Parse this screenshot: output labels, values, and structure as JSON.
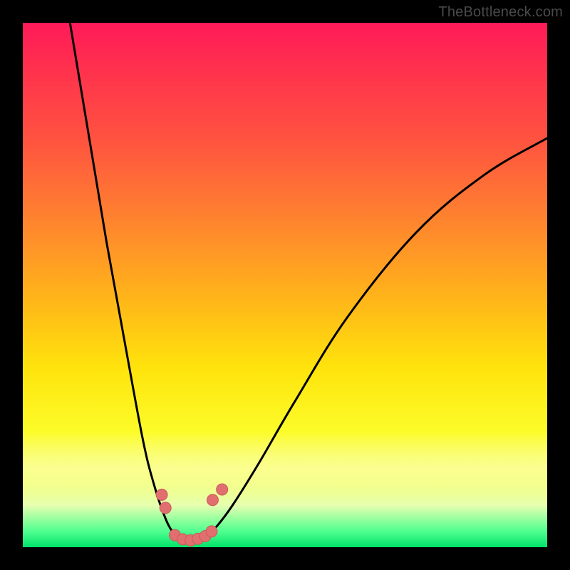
{
  "watermark": "TheBottleneck.com",
  "colors": {
    "background_frame": "#000000",
    "curve_stroke": "#000000",
    "marker_fill": "#e26f6f",
    "marker_stroke": "#c85a5a"
  },
  "chart_data": {
    "type": "line",
    "title": "",
    "xlabel": "",
    "ylabel": "",
    "xlim": [
      0,
      100
    ],
    "ylim": [
      0,
      100
    ],
    "grid": false,
    "legend": false,
    "note": "Conceptual bottleneck V-curve with no visible axis ticks or numeric labels; values are approximate geometry read from the plot area.",
    "series": [
      {
        "name": "left-branch",
        "x": [
          9,
          12,
          16,
          20,
          23,
          25,
          27,
          28.5,
          30
        ],
        "y": [
          100,
          82,
          58,
          36,
          20,
          12,
          6,
          3,
          1.5
        ]
      },
      {
        "name": "right-branch",
        "x": [
          35,
          37,
          40,
          45,
          52,
          62,
          75,
          88,
          100
        ],
        "y": [
          2,
          4,
          8,
          16,
          28,
          44,
          60,
          71,
          78
        ]
      },
      {
        "name": "valley-floor",
        "x": [
          28.5,
          30,
          32,
          34,
          35.5
        ],
        "y": [
          2,
          1.2,
          1,
          1.3,
          2
        ]
      }
    ],
    "markers": [
      {
        "x": 26.5,
        "y": 10,
        "r": 8
      },
      {
        "x": 27.2,
        "y": 7.5,
        "r": 8
      },
      {
        "x": 29,
        "y": 2.3,
        "r": 8
      },
      {
        "x": 30.5,
        "y": 1.5,
        "r": 8
      },
      {
        "x": 32,
        "y": 1.3,
        "r": 8
      },
      {
        "x": 33.4,
        "y": 1.6,
        "r": 8
      },
      {
        "x": 34.8,
        "y": 2.1,
        "r": 8
      },
      {
        "x": 36,
        "y": 3,
        "r": 8
      },
      {
        "x": 36.2,
        "y": 9,
        "r": 8
      },
      {
        "x": 38,
        "y": 11,
        "r": 8
      }
    ]
  }
}
